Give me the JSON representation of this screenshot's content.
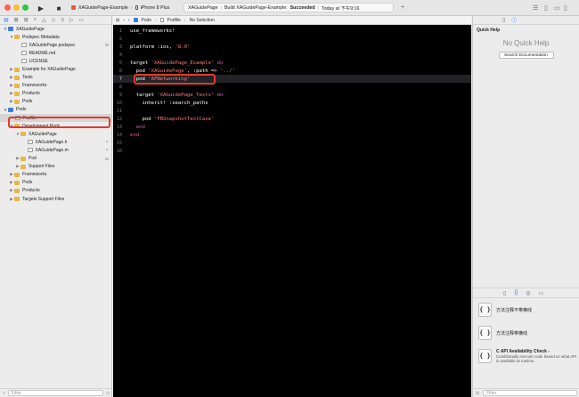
{
  "toolbar": {
    "scheme_name": "XAGuidePage-Example",
    "device": "iPhone 8 Plus",
    "activity_project": "XAGuidePage",
    "activity_status_prefix": "Build XAGuidePage-Example:",
    "activity_status": "Succeeded",
    "activity_time": "Today at 下午9:16",
    "colors": {
      "close": "#ff5f57",
      "minimize": "#febc2e",
      "zoom": "#28c840"
    }
  },
  "navigator": {
    "items": [
      {
        "label": "XAGuidePage",
        "status": "",
        "icon": "project-icon",
        "disclosure": "open"
      },
      {
        "label": "Podspec Metadata",
        "status": "",
        "icon": "folder-icon",
        "disclosure": "open"
      },
      {
        "label": "XAGuidePage.podspec",
        "status": "M",
        "icon": "file-icon",
        "disclosure": ""
      },
      {
        "label": "README.md",
        "status": "",
        "icon": "file-icon",
        "disclosure": ""
      },
      {
        "label": "LICENSE",
        "status": "",
        "icon": "file-icon",
        "disclosure": ""
      },
      {
        "label": "Example for XAGuidePage",
        "status": "",
        "icon": "folder-icon",
        "disclosure": "closed"
      },
      {
        "label": "Tests",
        "status": "",
        "icon": "folder-icon",
        "disclosure": "closed"
      },
      {
        "label": "Frameworks",
        "status": "",
        "icon": "folder-icon",
        "disclosure": "closed"
      },
      {
        "label": "Products",
        "status": "",
        "icon": "folder-icon",
        "disclosure": "closed"
      },
      {
        "label": "Pods",
        "status": "",
        "icon": "folder-icon",
        "disclosure": "closed"
      },
      {
        "label": "Pods",
        "status": "",
        "icon": "project-icon",
        "disclosure": "open"
      },
      {
        "label": "Podfile",
        "status": "",
        "icon": "file-icon",
        "disclosure": "",
        "selected": true
      },
      {
        "label": "Development Pods",
        "status": "",
        "icon": "folder-icon",
        "disclosure": "open"
      },
      {
        "label": "XAGuidePage",
        "status": "",
        "icon": "folder-icon",
        "disclosure": "open"
      },
      {
        "label": "XAGuidePage.h",
        "status": "?",
        "icon": "file-icon",
        "disclosure": ""
      },
      {
        "label": "XAGuidePage.m",
        "status": "?",
        "icon": "file-icon",
        "disclosure": ""
      },
      {
        "label": "Pod",
        "status": "M",
        "icon": "folder-icon",
        "disclosure": "closed"
      },
      {
        "label": "Support Files",
        "status": "",
        "icon": "folder-icon",
        "disclosure": "closed"
      },
      {
        "label": "Frameworks",
        "status": "",
        "icon": "folder-icon",
        "disclosure": "closed"
      },
      {
        "label": "Pods",
        "status": "",
        "icon": "folder-icon",
        "disclosure": "closed"
      },
      {
        "label": "Products",
        "status": "",
        "icon": "folder-icon",
        "disclosure": "closed"
      },
      {
        "label": "Targets Support Files",
        "status": "",
        "icon": "folder-icon",
        "disclosure": "closed"
      }
    ],
    "filter_placeholder": "Filter"
  },
  "jumpbar": {
    "crumbs": [
      "Pods",
      "Podfile",
      "No Selection"
    ]
  },
  "editor": {
    "current_line": 7,
    "lines": [
      [
        {
          "t": "use_frameworks!",
          "c": "plain"
        }
      ],
      [],
      [
        {
          "t": "platform ",
          "c": "plain"
        },
        {
          "t": ":ios",
          "c": "plain"
        },
        {
          "t": ", ",
          "c": "plain"
        },
        {
          "t": "'8.0'",
          "c": "str"
        }
      ],
      [],
      [
        {
          "t": "target ",
          "c": "plain"
        },
        {
          "t": "'XAGuidePage_Example'",
          "c": "str"
        },
        {
          "t": " do",
          "c": "kw"
        }
      ],
      [
        {
          "t": "  pod ",
          "c": "plain"
        },
        {
          "t": "'XAGuidePage'",
          "c": "str"
        },
        {
          "t": ", :path => ",
          "c": "plain"
        },
        {
          "t": "'../'",
          "c": "str"
        }
      ],
      [
        {
          "t": "  pod ",
          "c": "plain"
        },
        {
          "t": "'AFNetworking'",
          "c": "str"
        }
      ],
      [],
      [
        {
          "t": "  target ",
          "c": "plain"
        },
        {
          "t": "'XAGuidePage_Tests'",
          "c": "str"
        },
        {
          "t": " do",
          "c": "kw"
        }
      ],
      [
        {
          "t": "    inherit! :search_paths",
          "c": "plain"
        }
      ],
      [],
      [
        {
          "t": "    pod ",
          "c": "plain"
        },
        {
          "t": "'FBSnapshotTestCase'",
          "c": "str"
        }
      ],
      [
        {
          "t": "  end",
          "c": "kw"
        }
      ],
      [
        {
          "t": "end",
          "c": "kw"
        }
      ],
      [],
      []
    ]
  },
  "inspector": {
    "title": "Quick Help",
    "empty": "No Quick Help",
    "search_button": "Search Documentation"
  },
  "library": {
    "snippets": [
      {
        "title": "方法注释不带横线",
        "subtitle": ""
      },
      {
        "title": "方法注释带横线",
        "subtitle": ""
      },
      {
        "title": "C API Availability Check -",
        "subtitle": "Conditionally execute code based on what API is available at runtime."
      }
    ],
    "filter_placeholder": "Filter"
  }
}
